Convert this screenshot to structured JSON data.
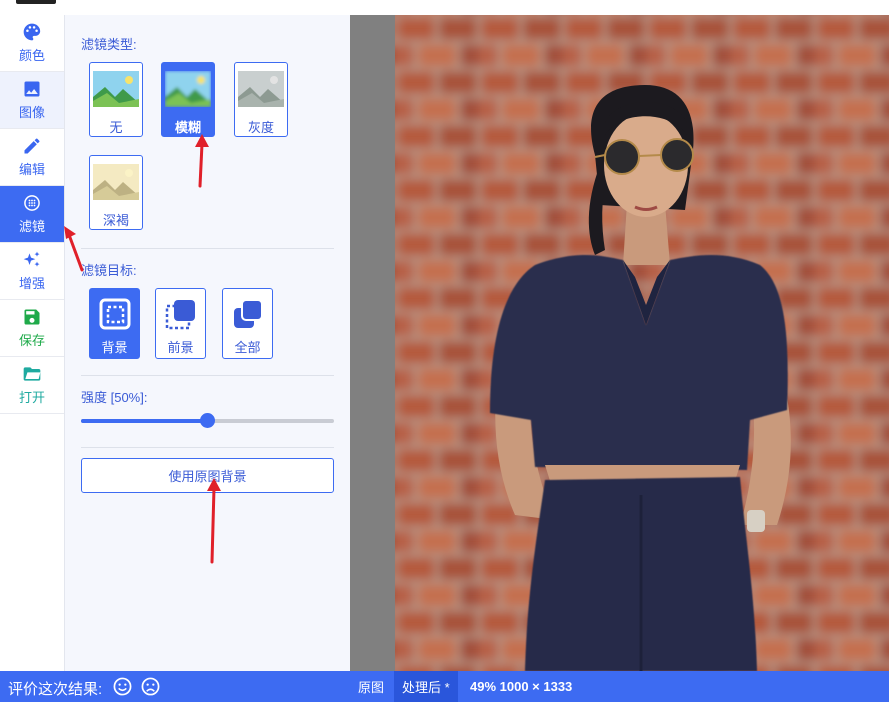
{
  "sidebar": {
    "items": [
      {
        "label": "颜色",
        "icon": "palette-icon"
      },
      {
        "label": "图像",
        "icon": "image-icon"
      },
      {
        "label": "编辑",
        "icon": "pencil-icon"
      },
      {
        "label": "滤镜",
        "icon": "filter-icon"
      },
      {
        "label": "增强",
        "icon": "sparkle-icon"
      },
      {
        "label": "保存",
        "icon": "save-icon"
      },
      {
        "label": "打开",
        "icon": "folder-open-icon"
      }
    ],
    "active_index": 3
  },
  "panel": {
    "filter_type_label": "滤镜类型:",
    "filter_types": [
      {
        "label": "无",
        "selected": false
      },
      {
        "label": "模糊",
        "selected": true
      },
      {
        "label": "灰度",
        "selected": false
      },
      {
        "label": "深褐",
        "selected": false
      }
    ],
    "target_label": "滤镜目标:",
    "targets": [
      {
        "label": "背景",
        "selected": true,
        "icon": "background-target-icon"
      },
      {
        "label": "前景",
        "selected": false,
        "icon": "foreground-target-icon"
      },
      {
        "label": "全部",
        "selected": false,
        "icon": "all-target-icon"
      }
    ],
    "strength_label": "强度 [50%]:",
    "strength_value": 0.5,
    "use_original_bg_label": "使用原图背景"
  },
  "statusbar": {
    "rate_label": "评价这次结果:",
    "smile_icon": "smile-icon",
    "frown_icon": "frown-icon",
    "tab_original": "原图",
    "tab_processed": "处理后 *",
    "info": "49% 1000 × 1333"
  },
  "colors": {
    "accent": "#3d6bf2",
    "panel_bg": "#f5f7fd",
    "save_green": "#1faa4a",
    "open_teal": "#1faaa0",
    "annotation_red": "#e0202a"
  }
}
